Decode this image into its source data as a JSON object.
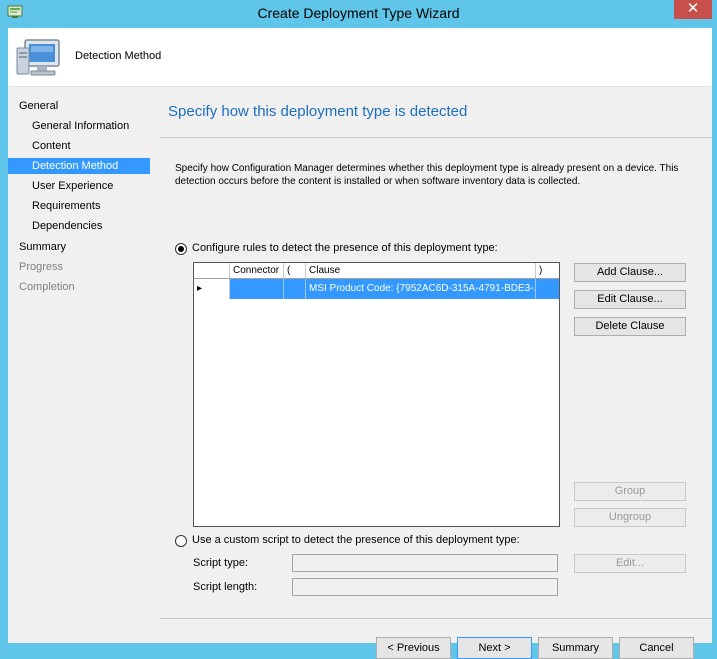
{
  "window": {
    "title": "Create Deployment Type Wizard",
    "close_glyph": "✕",
    "icon": "wizard-app-icon"
  },
  "header": {
    "icon": "computer-icon",
    "title": "Detection Method"
  },
  "nav": {
    "items": [
      {
        "label": "General",
        "level": "top",
        "state": "normal"
      },
      {
        "label": "General Information",
        "level": "sub",
        "state": "normal"
      },
      {
        "label": "Content",
        "level": "sub",
        "state": "normal"
      },
      {
        "label": "Detection Method",
        "level": "sub",
        "state": "selected"
      },
      {
        "label": "User Experience",
        "level": "sub",
        "state": "normal"
      },
      {
        "label": "Requirements",
        "level": "sub",
        "state": "normal"
      },
      {
        "label": "Dependencies",
        "level": "sub",
        "state": "normal"
      },
      {
        "label": "Summary",
        "level": "top",
        "state": "normal"
      },
      {
        "label": "Progress",
        "level": "top",
        "state": "disabled"
      },
      {
        "label": "Completion",
        "level": "top",
        "state": "disabled"
      }
    ]
  },
  "main": {
    "title": "Specify how this deployment type is detected",
    "description": "Specify how Configuration Manager determines whether this deployment type is already present on a device. This detection occurs before the content is installed or when software inventory data is collected.",
    "option_rules": {
      "label": "Configure rules to detect the presence of this deployment type:",
      "selected": true
    },
    "grid": {
      "columns": [
        "",
        "Connector",
        "(",
        "Clause",
        ")"
      ],
      "rows": [
        {
          "indicator": "▸",
          "connector": "",
          "open_paren": "",
          "clause": "MSI Product Code: {7952AC6D-315A-4791-BDE3-...",
          "close_paren": ""
        }
      ]
    },
    "clause_buttons": {
      "add": "Add Clause...",
      "edit": "Edit Clause...",
      "delete": "Delete Clause",
      "group": "Group",
      "ungroup": "Ungroup"
    },
    "option_script": {
      "label": "Use a custom script to detect the presence of this deployment type:",
      "selected": false
    },
    "script": {
      "type_label": "Script type:",
      "type_value": "",
      "length_label": "Script length:",
      "length_value": "",
      "edit_button": "Edit..."
    }
  },
  "footer": {
    "previous": "< Previous",
    "next": "Next >",
    "summary": "Summary",
    "cancel": "Cancel"
  },
  "colors": {
    "frame": "#5fc6ea",
    "accent": "#3399ff",
    "title_blue": "#1e6fbc",
    "close_red": "#c7504a"
  }
}
